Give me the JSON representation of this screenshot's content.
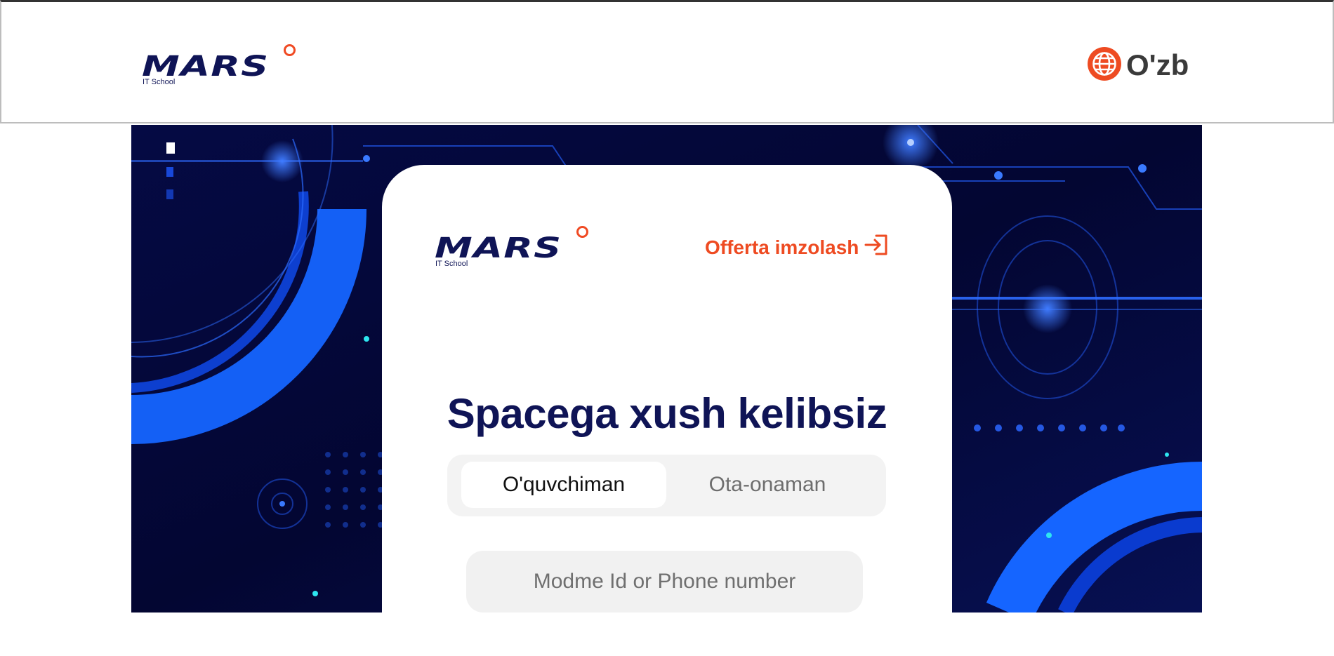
{
  "header": {
    "logo": {
      "word": "MARS",
      "sub": "IT School"
    },
    "language": {
      "label": "O'zb",
      "icon": "globe-icon"
    }
  },
  "card": {
    "logo": {
      "word": "MARS",
      "sub": "IT School"
    },
    "offerta_label": "Offerta imzolash",
    "offerta_icon": "sign-in-icon",
    "title": "Spacega xush kelibsiz",
    "tabs": [
      {
        "label": "O'quvchiman",
        "active": true
      },
      {
        "label": "Ota-onaman",
        "active": false
      }
    ],
    "login_input": {
      "placeholder": "Modme Id or Phone number",
      "value": ""
    }
  },
  "colors": {
    "brand_navy": "#0f1456",
    "accent_orange": "#ee4b22",
    "hero_bg": "#05083a"
  }
}
